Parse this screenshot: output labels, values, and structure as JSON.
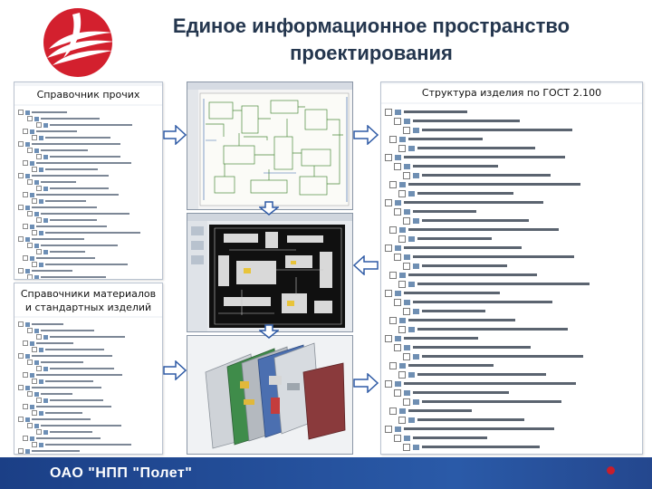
{
  "title": {
    "line1": "Единое информационное пространство",
    "line2": "проектирования"
  },
  "panels": {
    "other_items": {
      "label": "Справочник прочих изделий"
    },
    "materials": {
      "label": "Справочники материалов и стандартных изделий"
    },
    "structure": {
      "label": "Структура изделия по ГОСТ 2.100"
    }
  },
  "images": {
    "schematic": "circuit-schematic-icon",
    "pcb": "pcb-layout-icon",
    "assembly": "3d-exploded-assembly-icon"
  },
  "footer": {
    "company": "ОАО \"НПП \"Полет\""
  },
  "colors": {
    "title": "#24364e",
    "footer_bar": "#1b3f86",
    "logo_red": "#d3202e",
    "arrow_fill": "#ffffff",
    "arrow_stroke": "#2e5aa5"
  }
}
